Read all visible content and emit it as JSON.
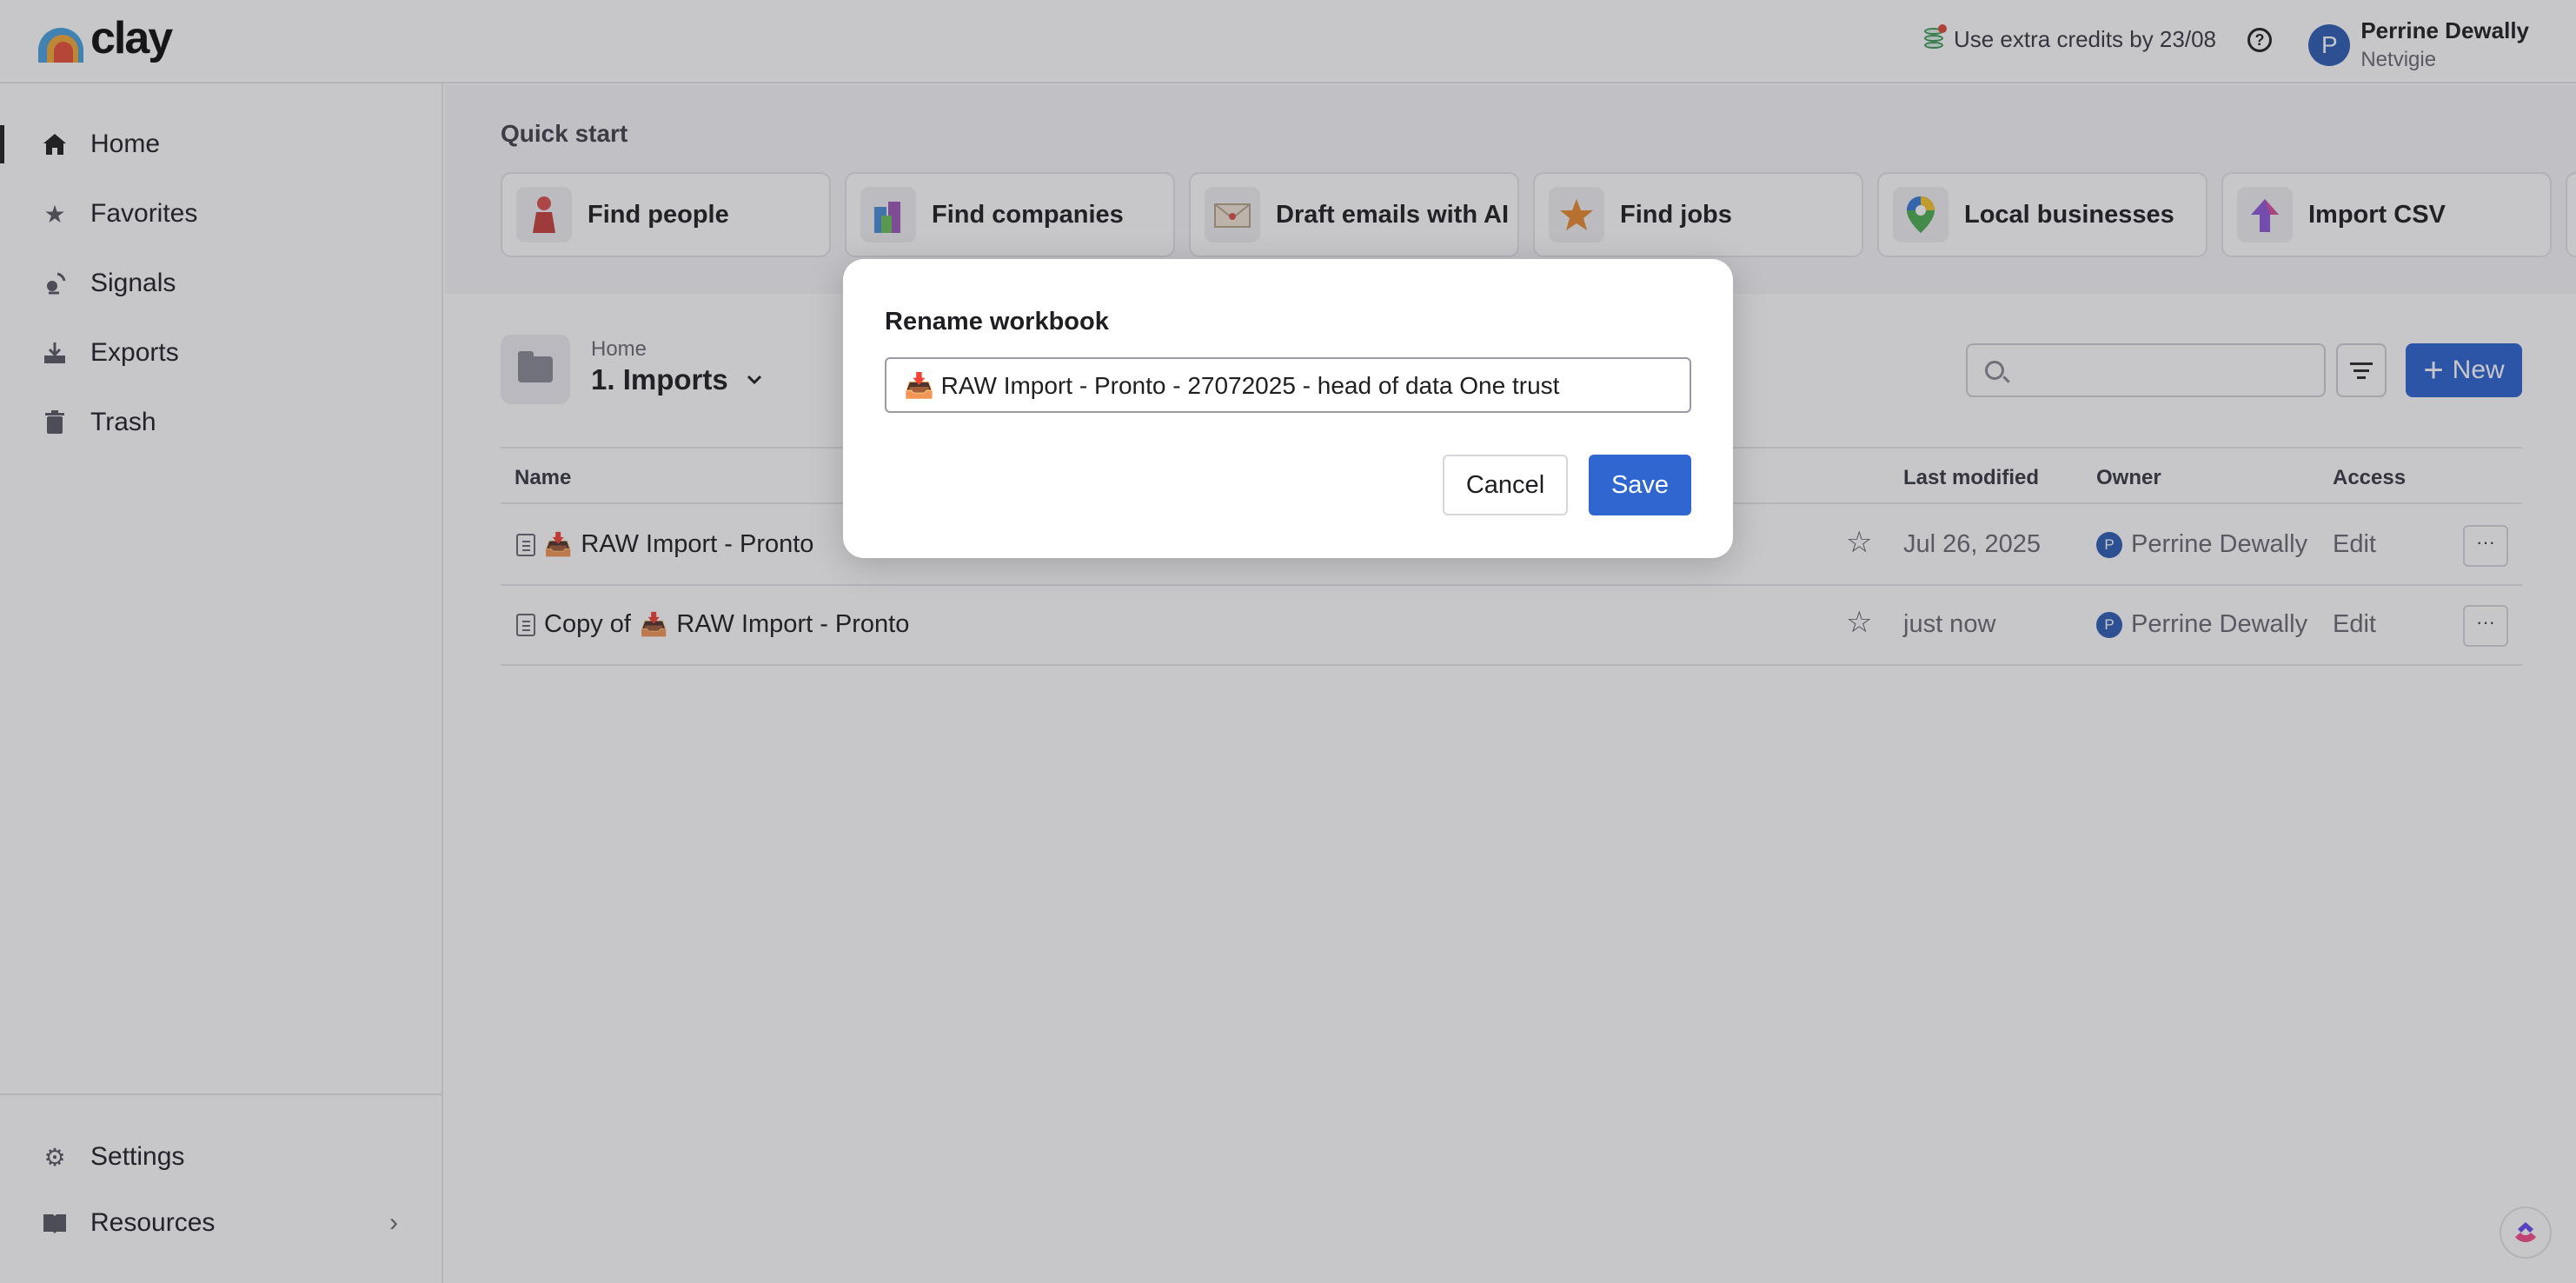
{
  "app": {
    "logo_text": "clay"
  },
  "topbar": {
    "credits_text": "Use extra credits by 23/08",
    "help_glyph": "?",
    "user": {
      "initial": "P",
      "name": "Perrine Dewally",
      "org": "Netvigie"
    }
  },
  "sidebar": {
    "items": [
      {
        "label": "Home",
        "icon": "home-icon"
      },
      {
        "label": "Favorites",
        "icon": "star-icon"
      },
      {
        "label": "Signals",
        "icon": "signal-icon"
      },
      {
        "label": "Exports",
        "icon": "export-icon"
      },
      {
        "label": "Trash",
        "icon": "trash-icon"
      }
    ],
    "bottom": [
      {
        "label": "Settings",
        "icon": "gear-icon"
      },
      {
        "label": "Resources",
        "icon": "book-icon"
      }
    ]
  },
  "quick_start": {
    "title": "Quick start",
    "cards": [
      {
        "label": "Find people",
        "icon": "person-icon"
      },
      {
        "label": "Find companies",
        "icon": "companies-icon"
      },
      {
        "label": "Draft emails with AI",
        "icon": "envelope-icon"
      },
      {
        "label": "Find jobs",
        "icon": "star-badge-icon"
      },
      {
        "label": "Local businesses",
        "icon": "map-pin-icon"
      },
      {
        "label": "Import CSV",
        "icon": "upload-arrow-icon"
      }
    ]
  },
  "folder": {
    "parent": "Home",
    "title": "1. Imports"
  },
  "toolbar": {
    "search_placeholder": "",
    "new_label": "New"
  },
  "table": {
    "headers": {
      "name": "Name",
      "modified": "Last modified",
      "owner": "Owner",
      "access": "Access"
    },
    "rows": [
      {
        "name": "RAW Import - Pronto",
        "prefix": "",
        "modified": "Jul 26, 2025",
        "owner_initial": "P",
        "owner": "Perrine Dewally",
        "access": "Edit",
        "more": "···"
      },
      {
        "name": "RAW Import - Pronto",
        "prefix": "Copy of",
        "modified": "just now",
        "owner_initial": "P",
        "owner": "Perrine Dewally",
        "access": "Edit",
        "more": "···"
      }
    ]
  },
  "modal": {
    "title": "Rename workbook",
    "input_value": "📥 RAW Import - Pronto - 27072025 - head of data One trust",
    "cancel_label": "Cancel",
    "save_label": "Save"
  },
  "colors": {
    "accent": "#2f66d0",
    "avatar": "#2f5fb4"
  }
}
